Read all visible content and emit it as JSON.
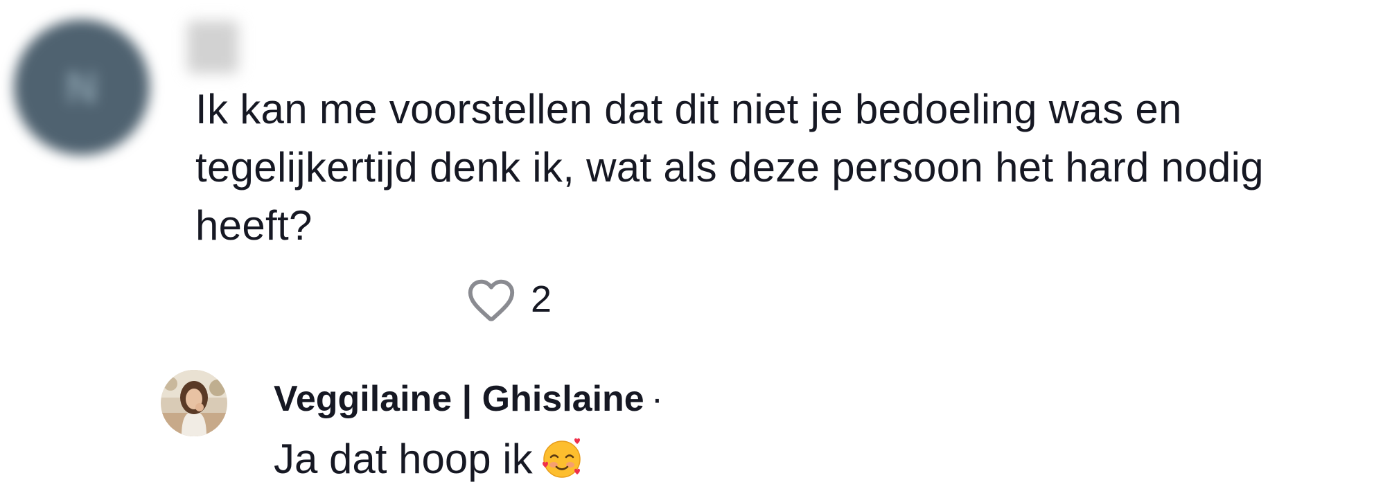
{
  "comment": {
    "avatar_initial": "N",
    "text": "Ik kan me voorstellen dat dit niet je bedoeling was en\ntegelijkertijd denk ik, wat als deze persoon het hard nodig\nheeft?",
    "like_count": "2"
  },
  "reply": {
    "author": "Veggilaine | Ghislaine",
    "separator": "·",
    "text": "Ja dat hoop ik",
    "emoji_icon": "smiling-face-with-hearts-icon"
  },
  "colors": {
    "text": "#161823",
    "heart_outline": "#8a8b91",
    "avatar_blur": "#4f6270"
  }
}
